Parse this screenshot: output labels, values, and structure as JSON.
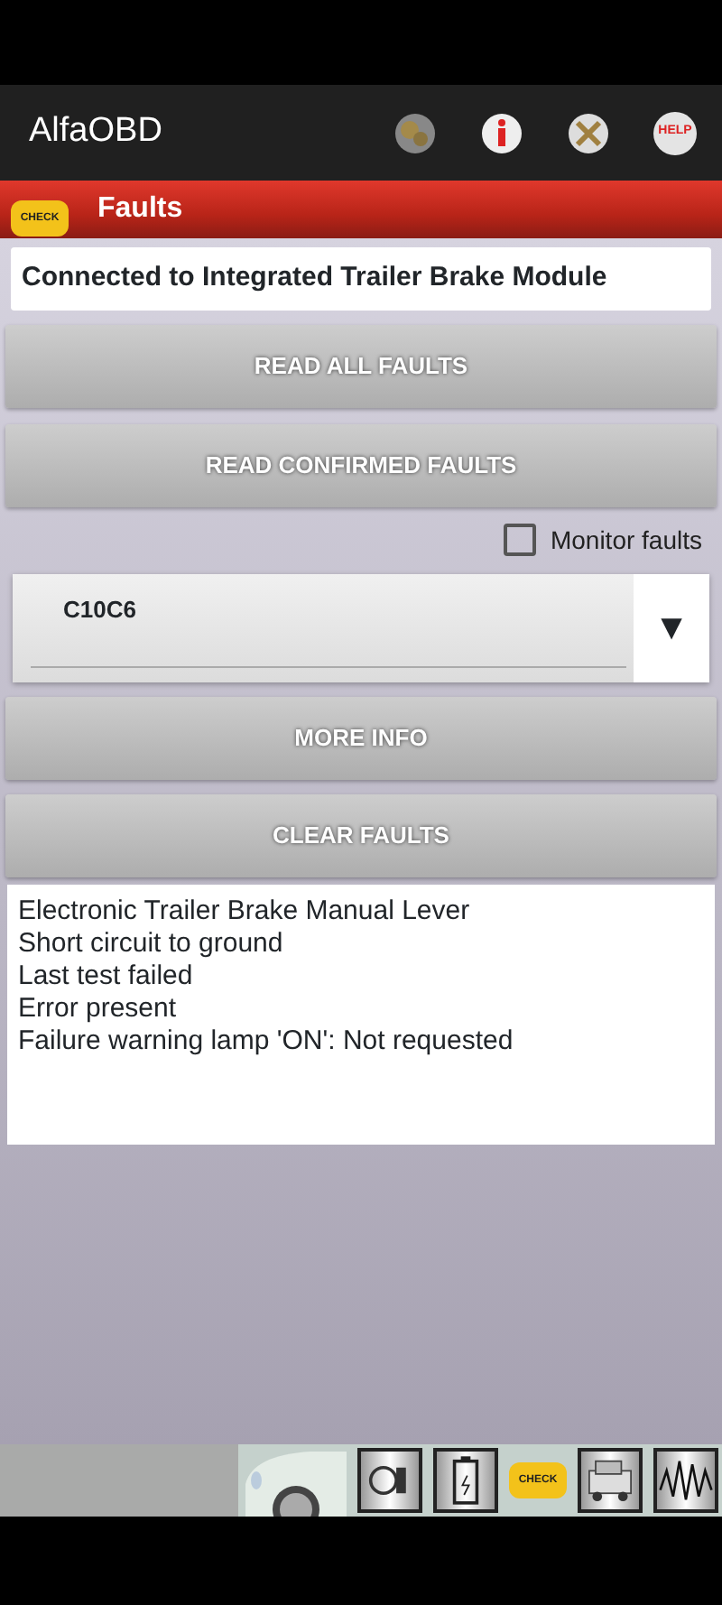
{
  "app_bar": {
    "title": "AlfaOBD",
    "help_icon_text": "HELP"
  },
  "section_bar": {
    "badge_text": "CHECK",
    "title": "Faults"
  },
  "connection": "Connected to Integrated Trailer Brake Module",
  "buttons_top": [
    "READ ALL FAULTS",
    "READ CONFIRMED FAULTS"
  ],
  "monitor": {
    "label": "Monitor faults",
    "checked": false
  },
  "fault_select": {
    "value": "C10C6",
    "arrow": "▼"
  },
  "buttons_bottom": [
    "MORE INFO",
    "CLEAR FAULTS"
  ],
  "details": [
    "Electronic Trailer Brake Manual Lever",
    "Short circuit to ground",
    "Last test failed",
    "Error present",
    "Failure warning lamp 'ON': Not requested"
  ],
  "bottom_bar": {
    "check_text": "CHECK"
  }
}
